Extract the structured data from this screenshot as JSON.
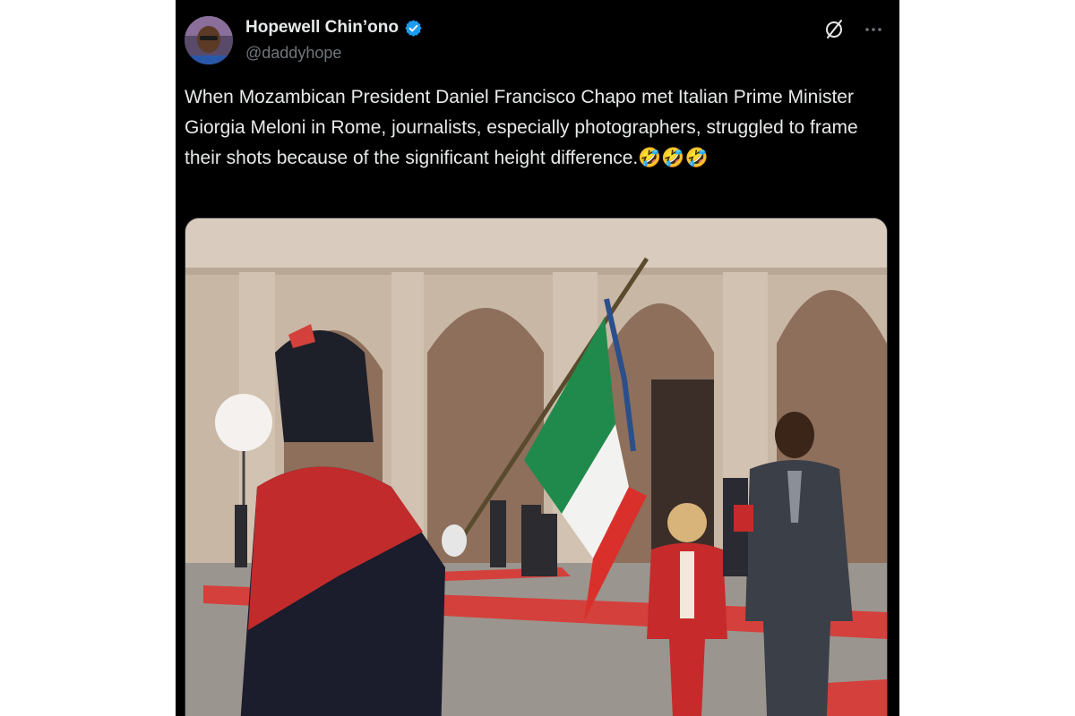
{
  "tweet": {
    "author_name": "Hopewell Chin’ono",
    "author_handle": "@daddyhope",
    "text": "When Mozambican President Daniel Francisco Chapo met Italian Prime Minister Giorgia Meloni in Rome, journalists, especially photographers, struggled to frame their shots because of the significant height difference.🤣🤣🤣",
    "verified": true
  },
  "icons": {
    "verified": "verified-badge-icon",
    "grok": "grok-icon",
    "more": "more-options-icon"
  },
  "colors": {
    "background": "#000000",
    "text": "#e7e9ea",
    "muted": "#71767b",
    "verified": "#1d9bf0"
  },
  "media": {
    "type": "video",
    "description_flag_colors": [
      "#1f8a4c",
      "#ffffff",
      "#d9302c"
    ]
  }
}
